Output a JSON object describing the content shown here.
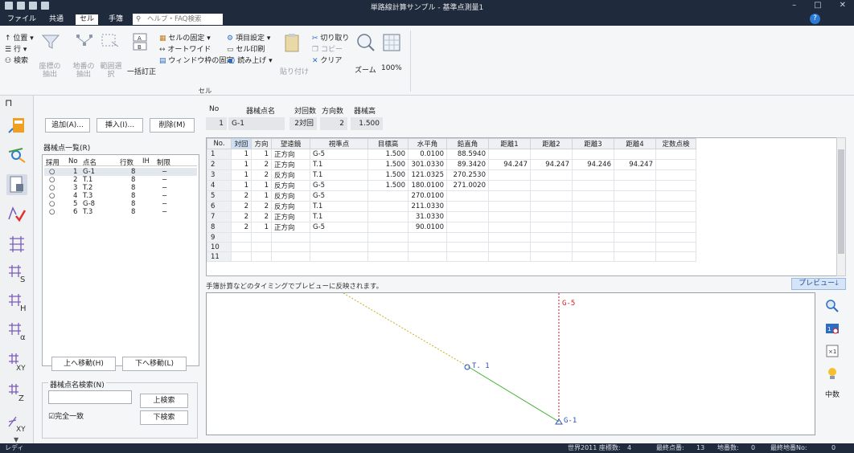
{
  "window": {
    "title": "単路線計算サンプル - 基準点測量1"
  },
  "menu": {
    "items": [
      "ファイル",
      "共通",
      "セル",
      "手簿"
    ],
    "active": "セル",
    "search_placeholder": "ヘルプ・FAQ検索"
  },
  "ribbon": {
    "position": "位置",
    "row": "行",
    "search": "検索",
    "coord_extract": "座標の抽出",
    "landno_extract": "地番の抽出",
    "range_select": "範囲選択",
    "batch_fix": "一括訂正",
    "cell_fix": "セルの固定",
    "autowide": "オートワイド",
    "freeze_window": "ウィンドウ枠の固定",
    "item_settings": "項目設定",
    "cell_print": "セル印刷",
    "read_aloud": "読み上げ",
    "paste": "貼り付け",
    "cut": "切り取り",
    "copy": "コピー",
    "clear": "クリア",
    "zoom": "ズーム",
    "zoom100": "100%",
    "group": "セル"
  },
  "panel": {
    "add": "追加(A)...",
    "insert": "挿入(I)...",
    "delete": "削除(M)",
    "list_title": "器械点一覧(R)",
    "columns": [
      "採用",
      "No",
      "点名",
      "行数",
      "IH",
      "制限"
    ],
    "rows": [
      {
        "adopt": "○",
        "no": "1",
        "name": "G-1",
        "count": "8",
        "ih": "",
        "limit": "−"
      },
      {
        "adopt": "○",
        "no": "2",
        "name": "T.1",
        "count": "8",
        "ih": "",
        "limit": "−"
      },
      {
        "adopt": "○",
        "no": "3",
        "name": "T.2",
        "count": "8",
        "ih": "",
        "limit": "−"
      },
      {
        "adopt": "○",
        "no": "4",
        "name": "T.3",
        "count": "8",
        "ih": "",
        "limit": "−"
      },
      {
        "adopt": "○",
        "no": "5",
        "name": "G-8",
        "count": "8",
        "ih": "",
        "limit": "−"
      },
      {
        "adopt": "○",
        "no": "6",
        "name": "T.3",
        "count": "8",
        "ih": "",
        "limit": "−"
      }
    ],
    "move_up": "上へ移動(H)",
    "move_down": "下へ移動(L)",
    "search_label": "器械点名検索(N)",
    "search_up": "上検索",
    "search_down": "下検索",
    "exact_match": "完全一致"
  },
  "header": {
    "labels": {
      "no": "No",
      "name": "器械点名",
      "pairs": "対回数",
      "dirs": "方向数",
      "height": "器械高"
    },
    "values": {
      "no": "1",
      "name": "G-1",
      "pairs": "2対回",
      "dirs": "2",
      "height": "1.500"
    }
  },
  "grid": {
    "columns": [
      "No.",
      "対回",
      "方向",
      "望遠鏡",
      "視準点",
      "目標高",
      "水平角",
      "鉛直角",
      "距離1",
      "距離2",
      "距離3",
      "距離4",
      "定数点検"
    ],
    "rows": [
      [
        "1",
        "1",
        "1",
        "正方向",
        "G-5",
        "1.500",
        "0.0100",
        "88.5940",
        "",
        "",
        "",
        "",
        ""
      ],
      [
        "2",
        "1",
        "2",
        "正方向",
        "T.1",
        "1.500",
        "301.0330",
        "89.3420",
        "94.247",
        "94.247",
        "94.246",
        "94.247",
        ""
      ],
      [
        "3",
        "1",
        "2",
        "反方向",
        "T.1",
        "1.500",
        "121.0325",
        "270.2530",
        "",
        "",
        "",
        "",
        ""
      ],
      [
        "4",
        "1",
        "1",
        "反方向",
        "G-5",
        "1.500",
        "180.0100",
        "271.0020",
        "",
        "",
        "",
        "",
        ""
      ],
      [
        "5",
        "2",
        "1",
        "反方向",
        "G-5",
        "",
        "270.0100",
        "",
        "",
        "",
        "",
        "",
        ""
      ],
      [
        "6",
        "2",
        "2",
        "反方向",
        "T.1",
        "",
        "211.0330",
        "",
        "",
        "",
        "",
        "",
        ""
      ],
      [
        "7",
        "2",
        "2",
        "正方向",
        "T.1",
        "",
        "31.0330",
        "",
        "",
        "",
        "",
        "",
        ""
      ],
      [
        "8",
        "2",
        "1",
        "正方向",
        "G-5",
        "",
        "90.0100",
        "",
        "",
        "",
        "",
        "",
        ""
      ],
      [
        "9",
        "",
        "",
        "",
        "",
        "",
        "",
        "",
        "",
        "",
        "",
        "",
        ""
      ],
      [
        "10",
        "",
        "",
        "",
        "",
        "",
        "",
        "",
        "",
        "",
        "",
        "",
        ""
      ],
      [
        "11",
        "",
        "",
        "",
        "",
        "",
        "",
        "",
        "",
        "",
        "",
        "",
        ""
      ]
    ]
  },
  "preview": {
    "info": "手簿計算などのタイミングでプレビューに反映されます。",
    "button": "プレビュー",
    "points": {
      "g5": "G-5",
      "t1": "T. 1",
      "g1": "G-1"
    },
    "colors": {
      "g5": "#d81b1b",
      "t1": "#2a4fbf",
      "g1": "#2a4fbf",
      "line_green": "#40b030",
      "line_yellow": "#c8b020"
    },
    "tool_center": "中数"
  },
  "status": {
    "ready": "レディ",
    "system": "世界2011 座標数:",
    "system_val": "4",
    "last_point": "最終点番:",
    "last_point_val": "13",
    "landno": "地番数:",
    "landno_val": "0",
    "last_landno": "最終地番No:",
    "last_landno_val": "0"
  }
}
